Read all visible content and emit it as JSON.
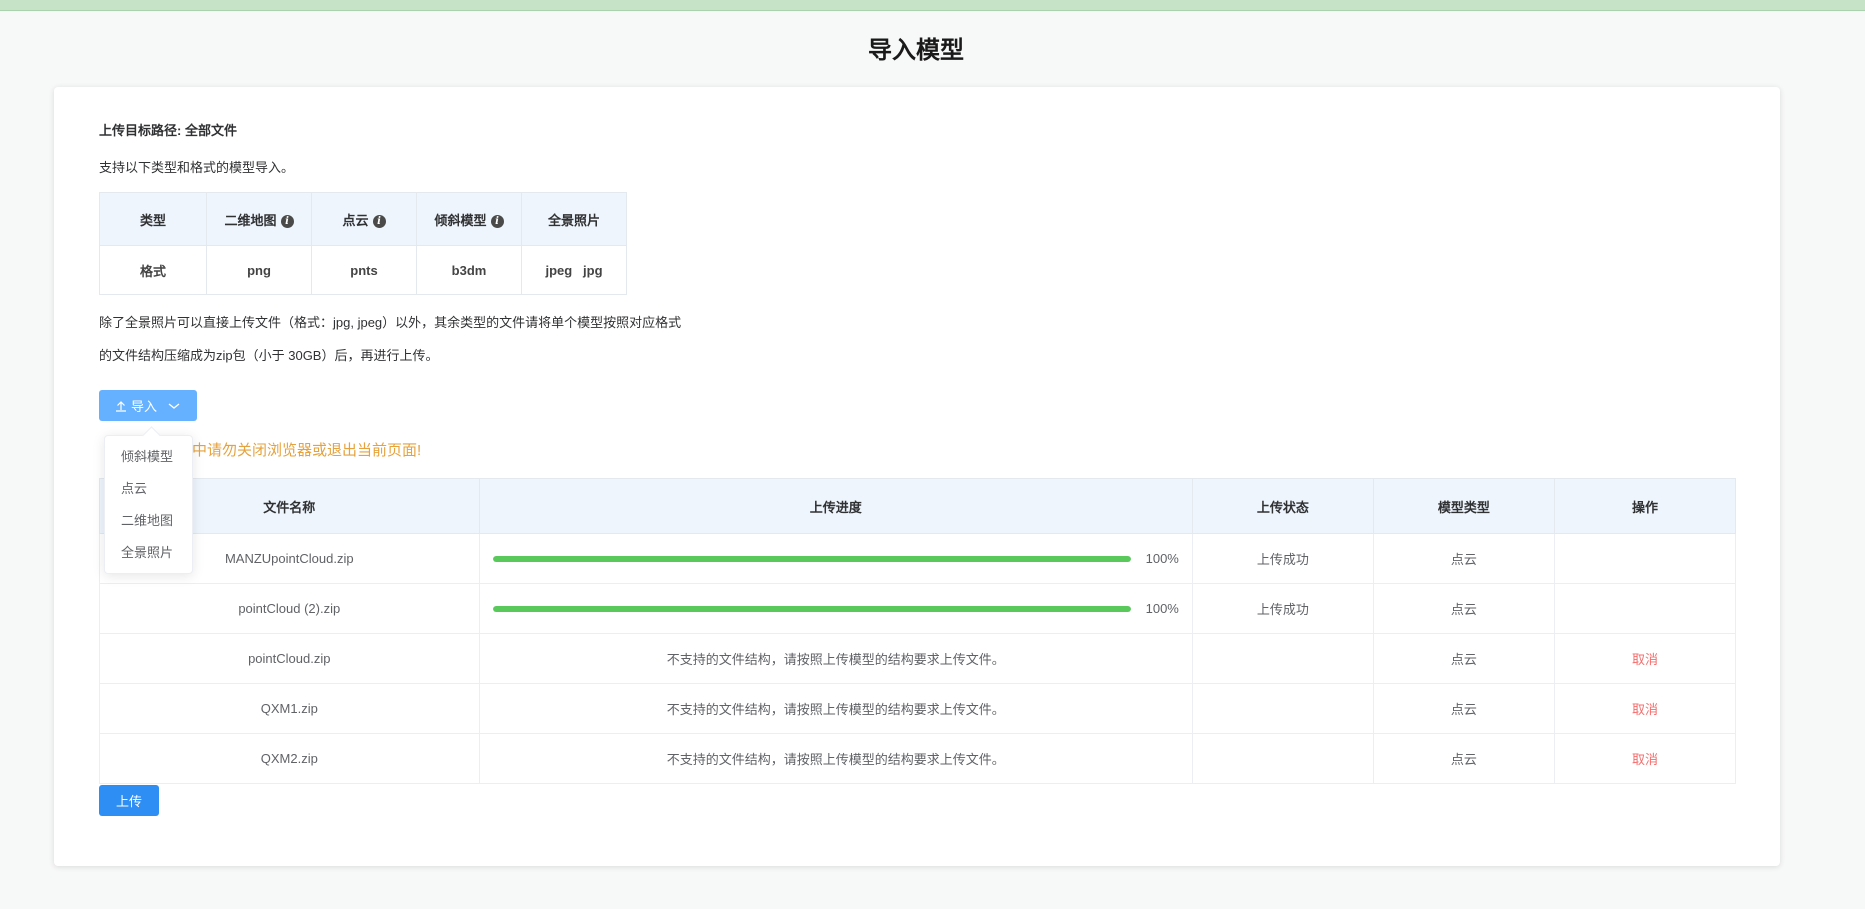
{
  "page_title": "导入模型",
  "target_path": "上传目标路径: 全部文件",
  "support_text": "支持以下类型和格式的模型导入。",
  "format_table": {
    "headers": [
      {
        "label": "类型",
        "info": false
      },
      {
        "label": "二维地图",
        "info": true
      },
      {
        "label": "点云",
        "info": true
      },
      {
        "label": "倾斜模型",
        "info": true
      },
      {
        "label": "全景照片",
        "info": false
      }
    ],
    "row": [
      "格式",
      "png",
      "pnts",
      "b3dm",
      "jpeg   jpg"
    ]
  },
  "note_line1": "除了全景照片可以直接上传文件（格式：jpg, jpeg）以外，其余类型的文件请将单个模型按照对应格式",
  "note_line2": "的文件结构压缩成为zip包（小于 30GB）后，再进行上传。",
  "import_button": {
    "label": "导入",
    "icon": "upload-icon",
    "arrow": "chevron-down-icon"
  },
  "dropdown_items": [
    "倾斜模型",
    "点云",
    "二维地图",
    "全景照片"
  ],
  "warning_text": "中请勿关闭浏览器或退出当前页面!",
  "files_table": {
    "columns": [
      "文件名称",
      "上传进度",
      "上传状态",
      "模型类型",
      "操作"
    ],
    "rows": [
      {
        "name": "MANZUpointCloud.zip",
        "progress": 100,
        "progress_text": "100%",
        "status": "上传成功",
        "type": "点云",
        "action": ""
      },
      {
        "name": "pointCloud (2).zip",
        "progress": 100,
        "progress_text": "100%",
        "status": "上传成功",
        "type": "点云",
        "action": ""
      },
      {
        "name": "pointCloud.zip",
        "message": "不支持的文件结构，请按照上传模型的结构要求上传文件。",
        "status": "",
        "type": "点云",
        "action": "取消"
      },
      {
        "name": "QXM1.zip",
        "message": "不支持的文件结构，请按照上传模型的结构要求上传文件。",
        "status": "",
        "type": "点云",
        "action": "取消"
      },
      {
        "name": "QXM2.zip",
        "message": "不支持的文件结构，请按照上传模型的结构要求上传文件。",
        "status": "",
        "type": "点云",
        "action": "取消"
      }
    ]
  },
  "upload_button": "上传",
  "colors": {
    "primary": "#2f8ef3",
    "primary_light": "#66b1ff",
    "success": "#58c95a",
    "warning": "#e6a23c",
    "danger": "#f56c6c"
  }
}
